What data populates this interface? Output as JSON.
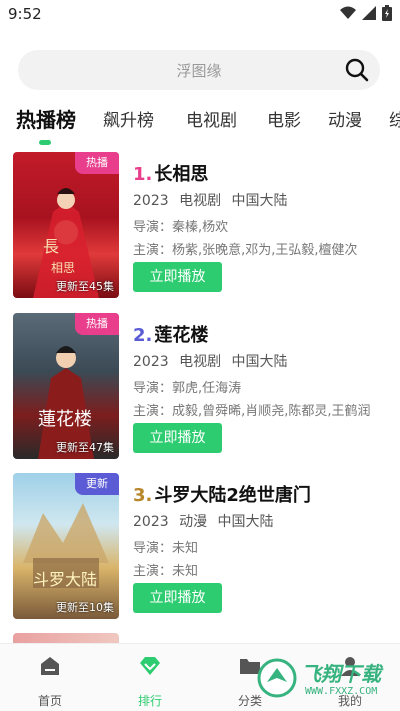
{
  "status": {
    "time": "9:52"
  },
  "search": {
    "placeholder": "浮图缘"
  },
  "tabs": [
    "热播榜",
    "飙升榜",
    "电视剧",
    "电影",
    "动漫",
    "综"
  ],
  "colors": {
    "accent": "#2ecc71",
    "hot_badge": "#e83e8c",
    "new_badge": "#5b5bd6"
  },
  "items": [
    {
      "rank": "1.",
      "rank_color": "#e83e8c",
      "title": "长相思",
      "badge": "热播",
      "badge_color": "#e83e8c",
      "progress": "更新至45集",
      "year": "2023",
      "category": "电视剧",
      "region": "中国大陆",
      "director": "导演：秦榛,杨欢",
      "cast": "主演：杨紫,张晚意,邓为,王弘毅,檀健次",
      "play": "立即播放"
    },
    {
      "rank": "2.",
      "rank_color": "#5b5bd6",
      "title": "莲花楼",
      "badge": "热播",
      "badge_color": "#e83e8c",
      "progress": "更新至47集",
      "year": "2023",
      "category": "电视剧",
      "region": "中国大陆",
      "director": "导演：郭虎,任海涛",
      "cast": "主演：成毅,曾舜晞,肖顺尧,陈都灵,王鹤润",
      "play": "立即播放"
    },
    {
      "rank": "3.",
      "rank_color": "#b8862b",
      "title": "斗罗大陆2绝世唐门",
      "badge": "更新",
      "badge_color": "#5b5bd6",
      "progress": "更新至10集",
      "year": "2023",
      "category": "动漫",
      "region": "中国大陆",
      "director": "导演：未知",
      "cast": "主演：未知",
      "play": "立即播放"
    }
  ],
  "nav": [
    {
      "label": "首页",
      "icon": "home-icon"
    },
    {
      "label": "排行",
      "icon": "ranking-diamond-icon"
    },
    {
      "label": "分类",
      "icon": "folder-icon"
    },
    {
      "label": "我的",
      "icon": "user-icon"
    }
  ],
  "watermark": {
    "text": "飞翔下载",
    "url": "WWW.FXXZ.COM"
  }
}
